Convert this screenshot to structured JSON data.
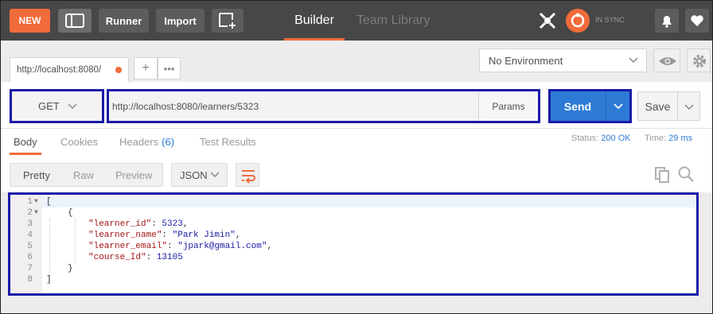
{
  "header": {
    "new_label": "NEW",
    "runner_label": "Runner",
    "import_label": "Import",
    "builder_tab": "Builder",
    "team_library_tab": "Team Library",
    "sync_status": "IN SYNC"
  },
  "tabs": {
    "request_tab_title": "http://localhost:8080/",
    "add_tab": "+",
    "more_tabs": "•••"
  },
  "environment": {
    "selected": "No Environment"
  },
  "request": {
    "method": "GET",
    "url": "http://localhost:8080/learners/5323",
    "params_label": "Params",
    "send_label": "Send",
    "save_label": "Save"
  },
  "response_tabs": {
    "body": "Body",
    "cookies": "Cookies",
    "headers": "Headers",
    "headers_count": "(6)",
    "test_results": "Test Results",
    "status_label": "Status:",
    "status_value": "200 OK",
    "time_label": "Time:",
    "time_value": "29 ms"
  },
  "response_toolbar": {
    "pretty": "Pretty",
    "raw": "Raw",
    "preview": "Preview",
    "format": "JSON"
  },
  "code": {
    "line_numbers": [
      "1",
      "2",
      "3",
      "4",
      "5",
      "6",
      "7",
      "8"
    ],
    "open_bracket": "[",
    "open_brace": "{",
    "learner_id_key": "\"learner_id\"",
    "learner_id_value": "5323",
    "learner_name_key": "\"learner_name\"",
    "learner_name_value": "\"Park Jimin\"",
    "learner_email_key": "\"learner_email\"",
    "learner_email_value": "\"jpark@gmail.com\"",
    "course_id_key": "\"course_Id\"",
    "course_id_value": "13105",
    "close_brace": "}",
    "close_bracket": "]"
  },
  "colors": {
    "accent": "#f26b3a",
    "send_blue": "#2e7bd6",
    "annotation_border": "#1a1aa6",
    "header_bg": "#474747"
  }
}
